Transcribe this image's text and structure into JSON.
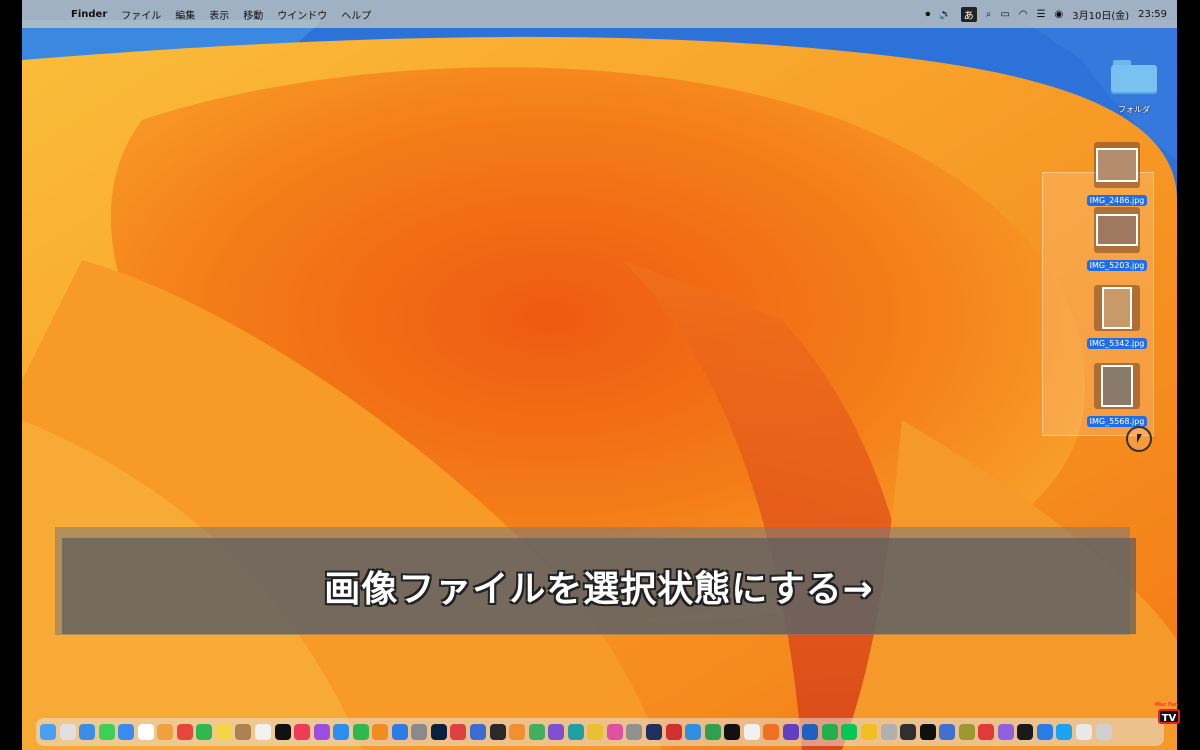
{
  "menubar": {
    "apple": "",
    "app_name": "Finder",
    "menus": [
      "ファイル",
      "編集",
      "表示",
      "移動",
      "ウインドウ",
      "ヘルプ"
    ],
    "status_icons": [
      "record-icon",
      "volume-icon",
      "input-method-icon",
      "search-icon",
      "battery-icon",
      "wifi-icon",
      "control-center-icon",
      "siri-icon"
    ],
    "input_method": "あ",
    "date": "3月10日(金)",
    "time": "23:59"
  },
  "desktop": {
    "folder_label": "フォルダ",
    "files": [
      {
        "name": "IMG_2486.jpg",
        "photo_color": "#b48c6e"
      },
      {
        "name": "IMG_5203.jpg",
        "photo_color": "#a07860"
      },
      {
        "name": "IMG_5342.jpg",
        "photo_color": "#c89a6a"
      },
      {
        "name": "IMG_5568.jpg",
        "photo_color": "#8a7a6a"
      }
    ]
  },
  "caption": "画像ファイルを選択状態にする→",
  "watermark": {
    "small": "Mac Fan",
    "big": "TV"
  },
  "colors": {
    "selection": "#1f6ee8",
    "folder": "#79c1f0",
    "wallpaper_orange": "#f27d16",
    "wallpaper_blue": "#2c6fd4"
  },
  "dock": {
    "icons": [
      {
        "name": "finder-icon",
        "color": "#4aa0f0"
      },
      {
        "name": "launchpad-icon",
        "color": "#e0e0e0"
      },
      {
        "name": "safari-icon",
        "color": "#3a8ee8"
      },
      {
        "name": "messages-icon",
        "color": "#3ccf5a"
      },
      {
        "name": "mail-icon",
        "color": "#3b8cf0"
      },
      {
        "name": "calendar-icon",
        "color": "#ffffff"
      },
      {
        "name": "photos-icon",
        "color": "#f0a040"
      },
      {
        "name": "chrome-icon",
        "color": "#e8453c"
      },
      {
        "name": "facetime-icon",
        "color": "#2fb84f"
      },
      {
        "name": "notes-icon",
        "color": "#f5d547"
      },
      {
        "name": "contacts-icon",
        "color": "#b08050"
      },
      {
        "name": "reminders-icon",
        "color": "#f2f2f2"
      },
      {
        "name": "appletv-icon",
        "color": "#111111"
      },
      {
        "name": "music-icon",
        "color": "#f03a5a"
      },
      {
        "name": "podcasts-icon",
        "color": "#9b4ee0"
      },
      {
        "name": "appstore-icon",
        "color": "#2c8cf0"
      },
      {
        "name": "numbers-icon",
        "color": "#2fb84f"
      },
      {
        "name": "pages-icon",
        "color": "#f08c20"
      },
      {
        "name": "keynote-icon",
        "color": "#2c7ce8"
      },
      {
        "name": "settings-icon",
        "color": "#8a8a8a"
      },
      {
        "name": "photoshop-icon",
        "color": "#0c2040"
      },
      {
        "name": "app-icon-red",
        "color": "#e04040"
      },
      {
        "name": "app-icon-blue",
        "color": "#3c6cd0"
      },
      {
        "name": "app-icon-dark",
        "color": "#2a2a2a"
      },
      {
        "name": "app-icon-orange",
        "color": "#f09030"
      },
      {
        "name": "app-icon-green",
        "color": "#40b060"
      },
      {
        "name": "app-icon-purple",
        "color": "#8050d0"
      },
      {
        "name": "app-icon-teal",
        "color": "#20a0a0"
      },
      {
        "name": "app-icon-yellow",
        "color": "#e8c030"
      },
      {
        "name": "app-icon-pink",
        "color": "#e050a0"
      },
      {
        "name": "app-icon-gray",
        "color": "#909090"
      },
      {
        "name": "app-icon-navy",
        "color": "#203060"
      },
      {
        "name": "app-icon-red2",
        "color": "#d03030"
      },
      {
        "name": "app-icon-blue2",
        "color": "#3090e0"
      },
      {
        "name": "app-icon-green2",
        "color": "#30a050"
      },
      {
        "name": "app-icon-black",
        "color": "#111111"
      },
      {
        "name": "app-icon-white",
        "color": "#f0f0f0"
      },
      {
        "name": "app-icon-orange2",
        "color": "#f07020"
      },
      {
        "name": "app-icon-purple2",
        "color": "#6040c0"
      },
      {
        "name": "app-icon-blue3",
        "color": "#2060c0"
      },
      {
        "name": "app-icon-green3",
        "color": "#20b050"
      },
      {
        "name": "line-icon",
        "color": "#06c755"
      },
      {
        "name": "app-icon-yellow2",
        "color": "#f0c020"
      },
      {
        "name": "app-icon-gray2",
        "color": "#b0b0b0"
      },
      {
        "name": "app-icon-dark2",
        "color": "#303030"
      },
      {
        "name": "xit-icon",
        "color": "#101010"
      },
      {
        "name": "app-icon-blue4",
        "color": "#4070d0"
      },
      {
        "name": "app-icon-olive",
        "color": "#9a9a30"
      },
      {
        "name": "app-icon-red3",
        "color": "#e03a3a"
      },
      {
        "name": "app-icon-violet",
        "color": "#9060e0"
      },
      {
        "name": "app-icon-black2",
        "color": "#1a1a1a"
      },
      {
        "name": "app-icon-blue5",
        "color": "#2a7ce8"
      },
      {
        "name": "twitter-icon",
        "color": "#1da1f2"
      },
      {
        "name": "downloads-icon",
        "color": "#e8e8e8"
      },
      {
        "name": "trash-icon",
        "color": "#cfcfcf"
      }
    ]
  }
}
